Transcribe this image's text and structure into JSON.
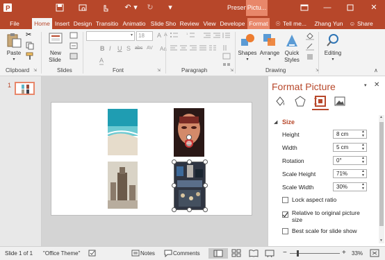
{
  "title_bar": {
    "title": "Presentatio...",
    "contextual_tab": "Pictu...",
    "restore_icon": "restore-ribbon-icon"
  },
  "tabs": [
    "File",
    "Home",
    "Insert",
    "Design",
    "Transitio",
    "Animatio",
    "Slide Sho",
    "Review",
    "View",
    "Develope",
    "Format"
  ],
  "tell_me": "Tell me...",
  "user": "Zhang Yun",
  "share": "Share",
  "ribbon": {
    "paste": "Paste",
    "new_slide": "New",
    "new_slide_2": "Slide",
    "font_name": "",
    "font_size": "18",
    "shapes": "Shapes",
    "arrange": "Arrange",
    "quick_styles": "Quick",
    "quick_styles_2": "Styles",
    "editing": "Editing",
    "groups": {
      "clipboard": "Clipboard",
      "slides": "Slides",
      "font": "Font",
      "paragraph": "Paragraph",
      "drawing": "Drawing"
    },
    "font_buttons": [
      "B",
      "I",
      "U",
      "S",
      "abc",
      "AV",
      "Aa",
      "A"
    ]
  },
  "thumbnail": {
    "number": "1"
  },
  "format_pane": {
    "title": "Format Picture",
    "section": "Size",
    "fields": [
      {
        "label": "Height",
        "value": "8 cm"
      },
      {
        "label": "Width",
        "value": "5 cm"
      },
      {
        "label": "Rotation",
        "value": "0°"
      },
      {
        "label": "Scale Height",
        "value": "71%"
      },
      {
        "label": "Scale Width",
        "value": "30%"
      }
    ],
    "checks": [
      {
        "label": "Lock aspect ratio",
        "checked": false
      },
      {
        "label": "Relative to original picture",
        "label2": "size",
        "checked": true
      },
      {
        "label": "Best scale for slide show",
        "checked": false
      }
    ]
  },
  "status": {
    "slide": "Slide 1 of 1",
    "theme": "\"Office Theme\"",
    "notes": "Notes",
    "comments": "Comments",
    "zoom": "33%"
  },
  "colors": {
    "accent": "#b7472a"
  }
}
